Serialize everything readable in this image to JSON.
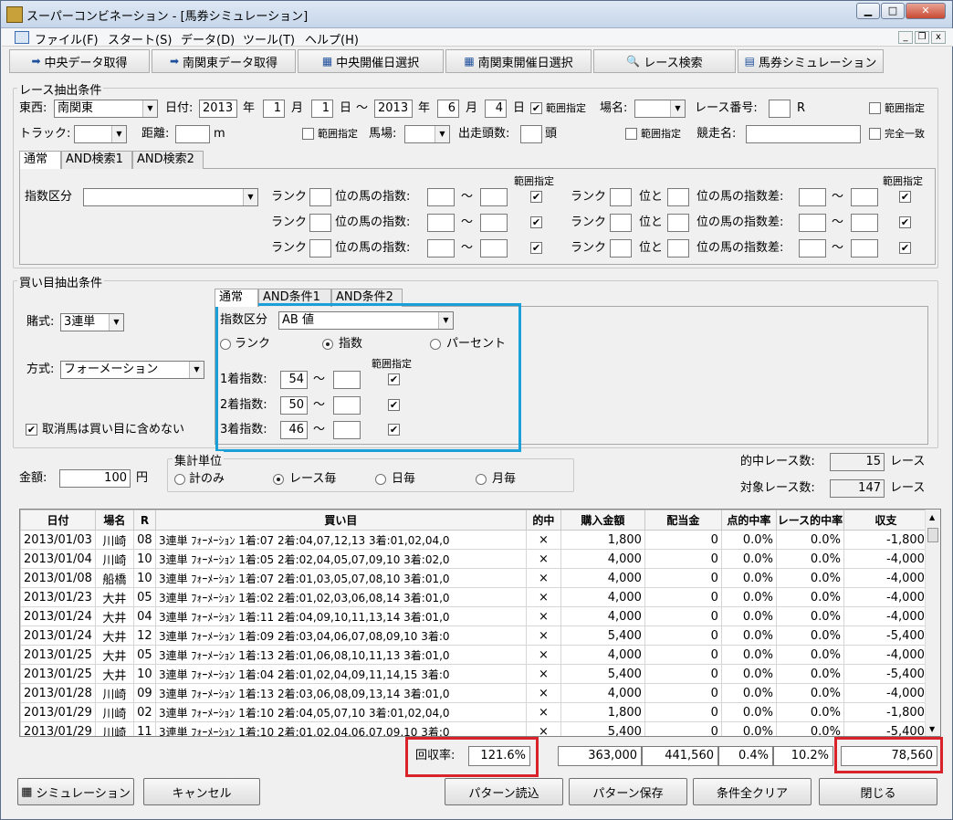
{
  "window": {
    "title": "スーパーコンビネーション - [馬券シミュレーション]"
  },
  "menu": [
    "ファイル(F)",
    "スタート(S)",
    "データ(D)",
    "ツール(T)",
    "ヘルプ(H)"
  ],
  "toolbar": [
    "中央データ取得",
    "南関東データ取得",
    "中央開催日選択",
    "南関東開催日選択",
    "レース検索",
    "馬券シミュレーション"
  ],
  "race": {
    "group_label": "レース抽出条件",
    "touzai_label": "東西:",
    "touzai_value": "南関東",
    "date_label": "日付:",
    "from_year": "2013",
    "year_unit": "年",
    "from_month": "1",
    "month_unit": "月",
    "from_day": "1",
    "day_unit": "日",
    "tilde": "～",
    "to_year": "2013",
    "to_month": "6",
    "to_day": "4",
    "range_label": "範囲指定",
    "place_label": "場名:",
    "place_value": "",
    "race_no_label": "レース番号:",
    "race_no_value": "",
    "race_no_unit": "R",
    "track_label": "トラック:",
    "track_value": "",
    "distance_label": "距離:",
    "distance_value": "",
    "distance_unit": "m",
    "baba_label": "馬場:",
    "baba_value": "",
    "heads_label": "出走頭数:",
    "heads_value": "",
    "heads_unit": "頭",
    "race_name_label": "競走名:",
    "race_name_value": "",
    "exact_label": "完全一致",
    "tabs": [
      "通常",
      "AND検索1",
      "AND検索2"
    ],
    "index_kind_label": "指数区分",
    "index_kind_value": "",
    "rank_label": "ランク",
    "pos_label": "位の馬の指数:",
    "to_label": "位と",
    "diff_label": "位の馬の指数差:"
  },
  "bet": {
    "group_label": "買い目抽出条件",
    "type_label": "賭式:",
    "type_value": "3連単",
    "method_label": "方式:",
    "method_value": "フォーメーション",
    "exclude_label": "取消馬は買い目に含めない",
    "tabs": [
      "通常",
      "AND条件1",
      "AND条件2"
    ],
    "index_kind_label": "指数区分",
    "index_kind_value": "AB 値",
    "radio_rank": "ランク",
    "radio_index": "指数",
    "radio_percent": "パーセント",
    "range_label": "範囲指定",
    "rows": [
      {
        "label": "1着指数:",
        "from": "54",
        "to": ""
      },
      {
        "label": "2着指数:",
        "from": "50",
        "to": ""
      },
      {
        "label": "3着指数:",
        "from": "46",
        "to": ""
      }
    ],
    "amount_label": "金額:",
    "amount_value": "100",
    "amount_unit": "円"
  },
  "aggregate": {
    "group_label": "集計単位",
    "options": [
      "計のみ",
      "レース毎",
      "日毎",
      "月毎"
    ],
    "selected": "レース毎",
    "hit_label": "的中レース数:",
    "hit_value": "15",
    "target_label": "対象レース数:",
    "target_value": "147",
    "race_unit": "レース"
  },
  "table": {
    "headers": [
      "日付",
      "場名",
      "R",
      "買い目",
      "的中",
      "購入金額",
      "配当金",
      "点的中率",
      "レース的中率",
      "収支"
    ],
    "rows": [
      [
        "2013/01/03",
        "川崎",
        "08",
        "3連単 ﾌｫｰﾒｰｼｮﾝ 1着:07 2着:04,07,12,13 3着:01,02,04,0",
        "×",
        "1,800",
        "0",
        "0.0%",
        "0.0%",
        "-1,800"
      ],
      [
        "2013/01/04",
        "川崎",
        "10",
        "3連単 ﾌｫｰﾒｰｼｮﾝ 1着:05 2着:02,04,05,07,09,10 3着:02,0",
        "×",
        "4,000",
        "0",
        "0.0%",
        "0.0%",
        "-4,000"
      ],
      [
        "2013/01/08",
        "船橋",
        "10",
        "3連単 ﾌｫｰﾒｰｼｮﾝ 1着:07 2着:01,03,05,07,08,10 3着:01,0",
        "×",
        "4,000",
        "0",
        "0.0%",
        "0.0%",
        "-4,000"
      ],
      [
        "2013/01/23",
        "大井",
        "05",
        "3連単 ﾌｫｰﾒｰｼｮﾝ 1着:02 2着:01,02,03,06,08,14 3着:01,0",
        "×",
        "4,000",
        "0",
        "0.0%",
        "0.0%",
        "-4,000"
      ],
      [
        "2013/01/24",
        "大井",
        "04",
        "3連単 ﾌｫｰﾒｰｼｮﾝ 1着:11 2着:04,09,10,11,13,14 3着:01,0",
        "×",
        "4,000",
        "0",
        "0.0%",
        "0.0%",
        "-4,000"
      ],
      [
        "2013/01/24",
        "大井",
        "12",
        "3連単 ﾌｫｰﾒｰｼｮﾝ 1着:09 2着:03,04,06,07,08,09,10 3着:0",
        "×",
        "5,400",
        "0",
        "0.0%",
        "0.0%",
        "-5,400"
      ],
      [
        "2013/01/25",
        "大井",
        "05",
        "3連単 ﾌｫｰﾒｰｼｮﾝ 1着:13 2着:01,06,08,10,11,13 3着:01,0",
        "×",
        "4,000",
        "0",
        "0.0%",
        "0.0%",
        "-4,000"
      ],
      [
        "2013/01/25",
        "大井",
        "10",
        "3連単 ﾌｫｰﾒｰｼｮﾝ 1着:04 2着:01,02,04,09,11,14,15 3着:0",
        "×",
        "5,400",
        "0",
        "0.0%",
        "0.0%",
        "-5,400"
      ],
      [
        "2013/01/28",
        "川崎",
        "09",
        "3連単 ﾌｫｰﾒｰｼｮﾝ 1着:13 2着:03,06,08,09,13,14 3着:01,0",
        "×",
        "4,000",
        "0",
        "0.0%",
        "0.0%",
        "-4,000"
      ],
      [
        "2013/01/29",
        "川崎",
        "02",
        "3連単 ﾌｫｰﾒｰｼｮﾝ 1着:10 2着:04,05,07,10 3着:01,02,04,0",
        "×",
        "1,800",
        "0",
        "0.0%",
        "0.0%",
        "-1,800"
      ],
      [
        "2013/01/29",
        "川崎",
        "11",
        "3連単 ﾌｫｰﾒｰｼｮﾝ 1着:10 2着:01,02,04,06,07,09,10 3着:0",
        "×",
        "5,400",
        "0",
        "0.0%",
        "0.0%",
        "-5,400"
      ]
    ]
  },
  "summary": {
    "recovery_label": "回収率:",
    "recovery_value": "121.6%",
    "purchase_total": "363,000",
    "payout_total": "441,560",
    "point_hit": "0.4%",
    "race_hit": "10.2%",
    "balance": "78,560"
  },
  "buttons": {
    "simulate": "シミュレーション",
    "cancel": "キャンセル",
    "load": "パターン読込",
    "save": "パターン保存",
    "clear": "条件全クリア",
    "close": "閉じる"
  },
  "colors": {
    "highlight": "#1a9fd8",
    "alert": "#d8232a"
  }
}
